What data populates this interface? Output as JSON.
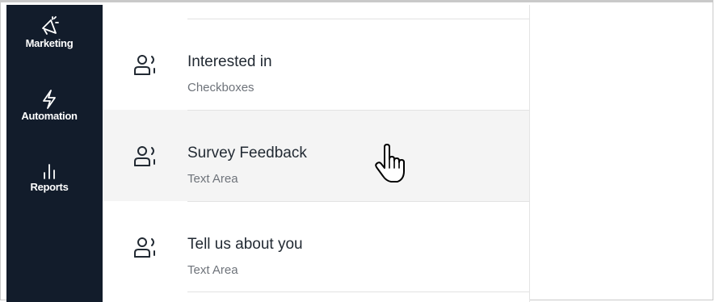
{
  "sidebar": {
    "items": [
      {
        "label": "Marketing",
        "icon": "megaphone-icon"
      },
      {
        "label": "Automation",
        "icon": "lightning-icon"
      },
      {
        "label": "Reports",
        "icon": "bar-chart-icon"
      }
    ]
  },
  "fields": [
    {
      "title": "Interested in",
      "type": "Checkboxes",
      "icon": "contact-field-icon"
    },
    {
      "title": "Survey Feedback",
      "type": "Text Area",
      "icon": "contact-field-icon"
    },
    {
      "title": "Tell us about you",
      "type": "Text Area",
      "icon": "contact-field-icon"
    }
  ],
  "colors": {
    "sidebar_bg": "#121c2b",
    "hover_row_bg": "#f4f4f4",
    "title_text": "#222a33",
    "subtitle_text": "#6e737a"
  }
}
